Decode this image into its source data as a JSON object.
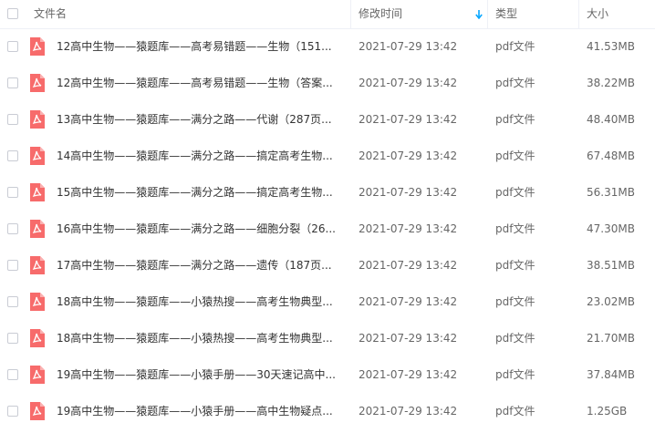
{
  "header": {
    "name_label": "文件名",
    "modified_label": "修改时间",
    "type_label": "类型",
    "size_label": "大小"
  },
  "files": [
    {
      "name": "12高中生物——猿题库——高考易错题——生物（151...",
      "modified": "2021-07-29 13:42",
      "type": "pdf文件",
      "size": "41.53MB"
    },
    {
      "name": "12高中生物——猿题库——高考易错题——生物（答案...",
      "modified": "2021-07-29 13:42",
      "type": "pdf文件",
      "size": "38.22MB"
    },
    {
      "name": "13高中生物——猿题库——满分之路——代谢（287页...",
      "modified": "2021-07-29 13:42",
      "type": "pdf文件",
      "size": "48.40MB"
    },
    {
      "name": "14高中生物——猿题库——满分之路——搞定高考生物...",
      "modified": "2021-07-29 13:42",
      "type": "pdf文件",
      "size": "67.48MB"
    },
    {
      "name": "15高中生物——猿题库——满分之路——搞定高考生物...",
      "modified": "2021-07-29 13:42",
      "type": "pdf文件",
      "size": "56.31MB"
    },
    {
      "name": "16高中生物——猿题库——满分之路——细胞分裂（26...",
      "modified": "2021-07-29 13:42",
      "type": "pdf文件",
      "size": "47.30MB"
    },
    {
      "name": "17高中生物——猿题库——满分之路——遗传（187页...",
      "modified": "2021-07-29 13:42",
      "type": "pdf文件",
      "size": "38.51MB"
    },
    {
      "name": "18高中生物——猿题库——小猿热搜——高考生物典型...",
      "modified": "2021-07-29 13:42",
      "type": "pdf文件",
      "size": "23.02MB"
    },
    {
      "name": "18高中生物——猿题库——小猿热搜——高考生物典型...",
      "modified": "2021-07-29 13:42",
      "type": "pdf文件",
      "size": "21.70MB"
    },
    {
      "name": "19高中生物——猿题库——小猿手册——30天速记高中...",
      "modified": "2021-07-29 13:42",
      "type": "pdf文件",
      "size": "37.84MB"
    },
    {
      "name": "19高中生物——猿题库——小猿手册——高中生物疑点...",
      "modified": "2021-07-29 13:42",
      "type": "pdf文件",
      "size": "1.25GB"
    }
  ],
  "icons": {
    "file_icon": "pdf-file-icon",
    "sort_icon": "arrow-down-icon"
  },
  "colors": {
    "pdf_icon": "#f76b6b",
    "sort_arrow": "#06a7ff"
  }
}
